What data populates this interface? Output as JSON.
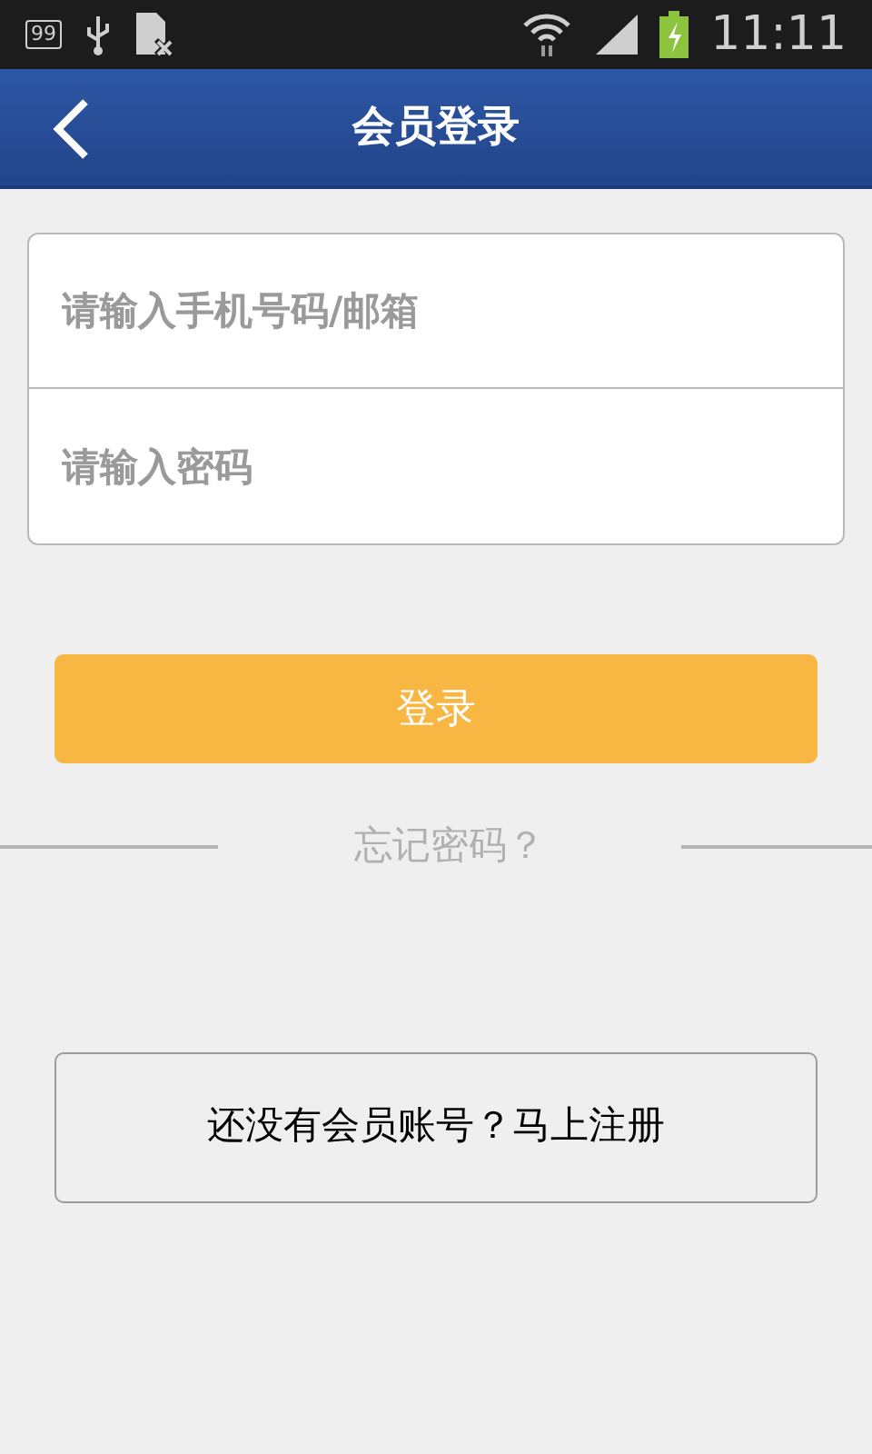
{
  "status_bar": {
    "notification_count": "99",
    "time": "11:11"
  },
  "header": {
    "title": "会员登录"
  },
  "form": {
    "fields": [
      {
        "placeholder": "请输入手机号码/邮箱"
      },
      {
        "placeholder": "请输入密码"
      }
    ],
    "login_button": "登录",
    "forgot_password": "忘记密码？"
  },
  "register_button": "还没有会员账号？马上注册"
}
